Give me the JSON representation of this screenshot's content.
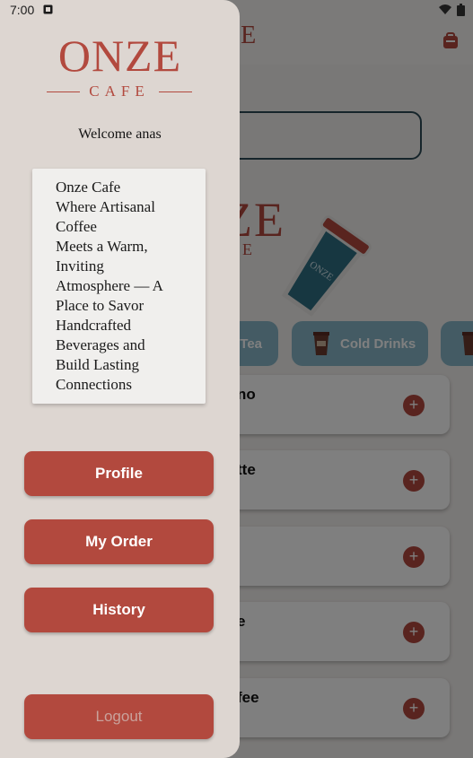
{
  "status_bar": {
    "time": "7:00"
  },
  "background": {
    "header_logo": "ZE",
    "hero_logo": "ZE",
    "hero_logo_sub": "E",
    "categories": [
      {
        "label": "Tea"
      },
      {
        "label": "Cold Drinks"
      }
    ],
    "products": [
      {
        "name": "no"
      },
      {
        "name": "tte"
      },
      {
        "name": ""
      },
      {
        "name": "e"
      },
      {
        "name": "fee"
      }
    ],
    "add_glyph": "+"
  },
  "drawer": {
    "logo_main": "ONZE",
    "logo_sub": "CAFE",
    "welcome": "Welcome anas",
    "tagline_lines": [
      "Onze Cafe",
      "Where Artisanal",
      "Coffee",
      "Meets a Warm,",
      "Inviting",
      "Atmosphere — A",
      "Place to Savor",
      "Handcrafted",
      "Beverages and",
      "Build Lasting",
      "Connections"
    ],
    "buttons": {
      "profile": "Profile",
      "my_order": "My Order",
      "history": "History",
      "logout": "Logout"
    }
  },
  "colors": {
    "brand": "#b2493e",
    "drawer_bg": "#ddd6d1",
    "category_bg": "#88b7c9"
  }
}
